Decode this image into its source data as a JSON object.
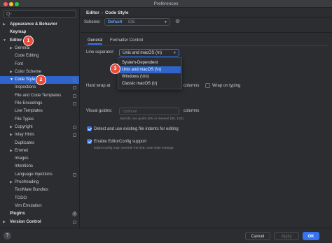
{
  "window": {
    "title": "Preferences"
  },
  "search": {
    "placeholder": "Q-"
  },
  "tree": [
    {
      "label": "Appearance & Behavior",
      "bold": true,
      "arrow": "▶",
      "indent": 0
    },
    {
      "label": "Keymap",
      "bold": true,
      "indent": 0
    },
    {
      "label": "Editor",
      "bold": true,
      "arrow": "▼",
      "indent": 0
    },
    {
      "label": "General",
      "arrow": "▶",
      "indent": 1
    },
    {
      "label": "Code Editing",
      "indent": 1
    },
    {
      "label": "Font",
      "indent": 1
    },
    {
      "label": "Color Scheme",
      "arrow": "▶",
      "indent": 1
    },
    {
      "label": "Code Style",
      "arrow": "▼",
      "indent": 1,
      "selected": true,
      "project_icon": true
    },
    {
      "label": "Inspections",
      "indent": 1,
      "project_icon": true
    },
    {
      "label": "File and Code Templates",
      "indent": 1,
      "project_icon": true
    },
    {
      "label": "File Encodings",
      "indent": 1,
      "project_icon": true
    },
    {
      "label": "Live Templates",
      "indent": 1
    },
    {
      "label": "File Types",
      "indent": 1
    },
    {
      "label": "Copyright",
      "arrow": "▶",
      "indent": 1,
      "project_icon": true
    },
    {
      "label": "Inlay Hints",
      "arrow": "▶",
      "indent": 1,
      "project_icon": true
    },
    {
      "label": "Duplicates",
      "indent": 1
    },
    {
      "label": "Emmet",
      "arrow": "▶",
      "indent": 1
    },
    {
      "label": "Images",
      "indent": 1
    },
    {
      "label": "Intentions",
      "indent": 1
    },
    {
      "label": "Language Injections",
      "indent": 1,
      "project_icon": true
    },
    {
      "label": "Proofreading",
      "arrow": "▶",
      "indent": 1
    },
    {
      "label": "TextMate Bundles",
      "indent": 1
    },
    {
      "label": "TODO",
      "indent": 1
    },
    {
      "label": "Vim Emulation",
      "indent": 1
    },
    {
      "label": "Plugins",
      "bold": true,
      "indent": 0,
      "badge": "2"
    },
    {
      "label": "Version Control",
      "bold": true,
      "arrow": "▶",
      "indent": 0,
      "project_icon": true
    }
  ],
  "breadcrumb": {
    "parent": "Editor",
    "separator": "›",
    "current": "Code Style"
  },
  "scheme": {
    "label": "Scheme:",
    "value_bold": "Default",
    "value_suffix": "IDE"
  },
  "tabs": [
    {
      "label": "General",
      "active": true
    },
    {
      "label": "Formatter Control"
    }
  ],
  "line_separator": {
    "label": "Line separator:",
    "value": "Unix and macOS (\\n)",
    "options": [
      {
        "label": "System-Dependent"
      },
      {
        "label": "Unix and macOS (\\n)",
        "selected": true
      },
      {
        "label": "Windows (\\r\\n)"
      },
      {
        "label": "Classic macOS (\\r)"
      }
    ]
  },
  "hard_wrap": {
    "label": "Hard wrap at",
    "unit": "columns",
    "wrap_on_typing": "Wrap on typing"
  },
  "visual_guides": {
    "label": "Visual guides:",
    "placeholder": "Optional",
    "unit": "columns",
    "hint": "Specify one guide (80) or several (80, 120)"
  },
  "checkboxes": [
    {
      "label": "Detect and use existing file indents for editing",
      "checked": true
    },
    {
      "label": "Enable EditorConfig support",
      "checked": true,
      "hint": "EditorConfig may override the IDE code style settings"
    }
  ],
  "markers": [
    "1",
    "2",
    "3",
    "4"
  ],
  "buttons": {
    "help": "?",
    "cancel": "Cancel",
    "apply": "Apply",
    "ok": "OK"
  },
  "colors": {
    "accent": "#3574f0",
    "selection": "#2f65ca",
    "marker": "#ec4b3a"
  }
}
